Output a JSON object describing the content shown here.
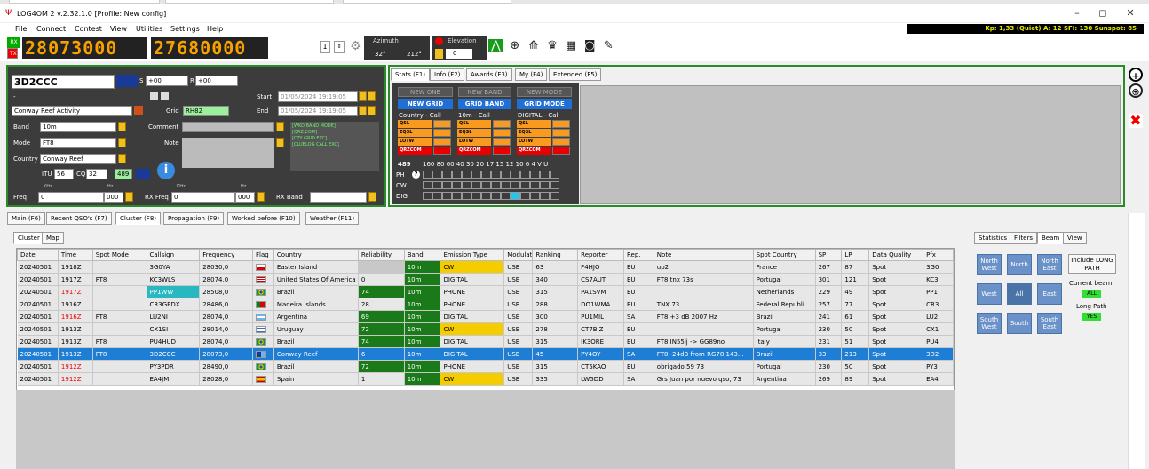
{
  "window": {
    "title": "LOG4OM 2 v.2.32.1.0 [Profile: New config]",
    "min": "–",
    "max": "◻",
    "close": "✕"
  },
  "menu": [
    "File",
    "Connect",
    "Contest",
    "View",
    "Utilities",
    "Settings",
    "Help"
  ],
  "kp_line": "Kp: 1,33 (Quiet) A: 12 SFI: 130 Sunspot: 85",
  "toolbar": {
    "rx": "RX",
    "tx": "TX",
    "freq_main": "28073000",
    "freq_sub": "27680000",
    "step": "1",
    "azimuth_label": "Azimuth",
    "az_val1": "32°",
    "az_val2": "212°",
    "elevation_label": "Elevation",
    "elevation_val": "0"
  },
  "entry": {
    "callsign": "3D2CCC",
    "s_label": "S",
    "s_val": "+00",
    "r_label": "R",
    "r_val": "+00",
    "dash": "-",
    "activity": "Conway Reef Activity",
    "grid_label": "Grid",
    "grid_val": "RH82",
    "start_label": "Start",
    "start_val": "01/05/2024 19:19:05",
    "end_label": "End",
    "end_val": "01/05/2024 19:19:05",
    "band_label": "Band",
    "band_val": "10m",
    "comment_label": "Comment",
    "mode_label": "Mode",
    "mode_val": "FT8",
    "note_label": "Note",
    "country_label": "Country",
    "country_val": "Conway Reef",
    "itu_label": "ITU",
    "itu_val": "56",
    "cq_label": "CQ",
    "cq_val": "32",
    "dxcc": "489",
    "khz1": "KHz",
    "hz1": "Hz",
    "khz2": "KHz",
    "hz2": "Hz",
    "freq_label": "Freq",
    "freq_val": "0",
    "freq_hz": "000",
    "rxfreq_label": "RX Freq",
    "rxfreq_val": "0",
    "rxfreq_hz": "000",
    "rxband_label": "RX Band",
    "info_lines": [
      "[WKD BAND MODE]",
      "[QRZ.COM]",
      "[CTY GRID EXC]",
      "[CLUBLOG CALL EXC]"
    ]
  },
  "stats_tabs": [
    "Stats (F1)",
    "Info (F2)",
    "Awards (F3)",
    "My (F4)",
    "Extended (F5)"
  ],
  "stats": {
    "new_one": "NEW ONE",
    "new_band": "NEW BAND",
    "new_mode": "NEW MODE",
    "new_grid": "NEW GRID",
    "grid_band": "GRID BAND",
    "grid_mode": "GRID MODE",
    "col1": "Country - Call",
    "col2": "10m - Call",
    "col3": "DIGITAL - Call",
    "labels": [
      "QSL",
      "EQSL",
      "LOTW",
      "QRZCOM"
    ],
    "dxcc": "489",
    "bands": "160 80 60 40 30 20 17 15 12 10 6 4 V U",
    "ph": "PH",
    "cw": "CW",
    "dig": "DIG"
  },
  "main_tabs": [
    "Main (F6)",
    "Recent QSO's (F7)",
    "Cluster (F8)",
    "Propagation (F9)",
    "Worked before (F10)",
    "Weather (F11)"
  ],
  "sub_tabs": [
    "Cluster",
    "Map"
  ],
  "right_tabs": [
    "Statistics",
    "Filters",
    "Beam",
    "View"
  ],
  "beam": {
    "nw": "North West",
    "n": "North",
    "ne": "North East",
    "w": "West",
    "all": "All",
    "e": "East",
    "sw": "South West",
    "s": "South",
    "se": "South East",
    "include": "Include LONG PATH",
    "current_beam": "Current beam",
    "all_val": "ALL",
    "long_path": "Long Path",
    "yes": "YES"
  },
  "table": {
    "headers": [
      "Date",
      "Time",
      "Spot Mode",
      "Callsign",
      "Frequency",
      "Flag",
      "Country",
      "Reliability",
      "Band",
      "Emission Type",
      "Modulat",
      "Ranking",
      "Reporter",
      "Rep.",
      "Note",
      "Spot Country",
      "SP",
      "LP",
      "Data Quality",
      "Pfx"
    ],
    "rows": [
      [
        "20240501",
        "1918Z",
        "",
        "3G0YA",
        "28030,0",
        "cl",
        "Easter Island",
        "",
        "10m",
        "CW",
        "USB",
        "63",
        "F4HJO",
        "EU",
        "up2",
        "France",
        "267",
        "87",
        "Spot",
        "3G0"
      ],
      [
        "20240501",
        "1917Z",
        "FT8",
        "KC3WLS",
        "28074,0",
        "us",
        "United States Of America",
        "0",
        "10m",
        "DIGITAL",
        "USB",
        "340",
        "CS7AUT",
        "EU",
        "FT8 tnx 73s",
        "Portugal",
        "301",
        "121",
        "Spot",
        "KC3"
      ],
      [
        "20240501",
        "1917Z",
        "",
        "PP1WW",
        "28508,0",
        "br",
        "Brazil",
        "74",
        "10m",
        "PHONE",
        "USB",
        "315",
        "PA1SVM",
        "EU",
        "",
        "Netherlands",
        "229",
        "49",
        "Spot",
        "PP1"
      ],
      [
        "20240501",
        "1916Z",
        "",
        "CR3GPDX",
        "28486,0",
        "pt",
        "Madeira Islands",
        "28",
        "10m",
        "PHONE",
        "USB",
        "288",
        "DO1WMA",
        "EU",
        "TNX 73",
        "Federal Republi...",
        "257",
        "77",
        "Spot",
        "CR3"
      ],
      [
        "20240501",
        "1916Z",
        "FT8",
        "LU2NI",
        "28074,0",
        "ar",
        "Argentina",
        "69",
        "10m",
        "DIGITAL",
        "USB",
        "300",
        "PU1MIL",
        "SA",
        "FT8 +3 dB 2007 Hz",
        "Brazil",
        "241",
        "61",
        "Spot",
        "LU2"
      ],
      [
        "20240501",
        "1913Z",
        "",
        "CX1SI",
        "28014,0",
        "uy",
        "Uruguay",
        "72",
        "10m",
        "CW",
        "USB",
        "278",
        "CT7BIZ",
        "EU",
        "",
        "Portugal",
        "230",
        "50",
        "Spot",
        "CX1"
      ],
      [
        "20240501",
        "1913Z",
        "FT8",
        "PU4HUD",
        "28074,0",
        "br",
        "Brazil",
        "74",
        "10m",
        "DIGITAL",
        "USB",
        "315",
        "IK3ORE",
        "EU",
        "FT8 IN55lj -> GG89no",
        "Italy",
        "231",
        "51",
        "Spot",
        "PU4"
      ],
      [
        "20240501",
        "1913Z",
        "FT8",
        "3D2CCC",
        "28073,0",
        "fj",
        "Conway Reef",
        "6",
        "10m",
        "DIGITAL",
        "USB",
        "45",
        "PY4OY",
        "SA",
        "FT8 -24dB from RG78 143...",
        "Brazil",
        "33",
        "213",
        "Spot",
        "3D2"
      ],
      [
        "20240501",
        "1912Z",
        "",
        "PY3PDR",
        "28490,0",
        "br",
        "Brazil",
        "72",
        "10m",
        "PHONE",
        "USB",
        "315",
        "CT5KAO",
        "EU",
        "obrigado 59 73",
        "Portugal",
        "230",
        "50",
        "Spot",
        "PY3"
      ],
      [
        "20240501",
        "1912Z",
        "",
        "EA4JM",
        "28028,0",
        "es",
        "Spain",
        "1",
        "10m",
        "CW",
        "USB",
        "335",
        "LW5DD",
        "SA",
        "Grs Juan por nuevo qso, 73",
        "Argentina",
        "269",
        "89",
        "Spot",
        "EA4"
      ]
    ]
  },
  "colors": {
    "green_border": "#2a8a2a",
    "selected_row": "#1e7dd4",
    "orange": "#f79a1f",
    "red": "#e80000",
    "cw_yellow": "#f5cc00",
    "rel_green": "#1a7a1a",
    "band_green": "#1a7a1a",
    "pp1_cyan": "#2ab8c0"
  }
}
